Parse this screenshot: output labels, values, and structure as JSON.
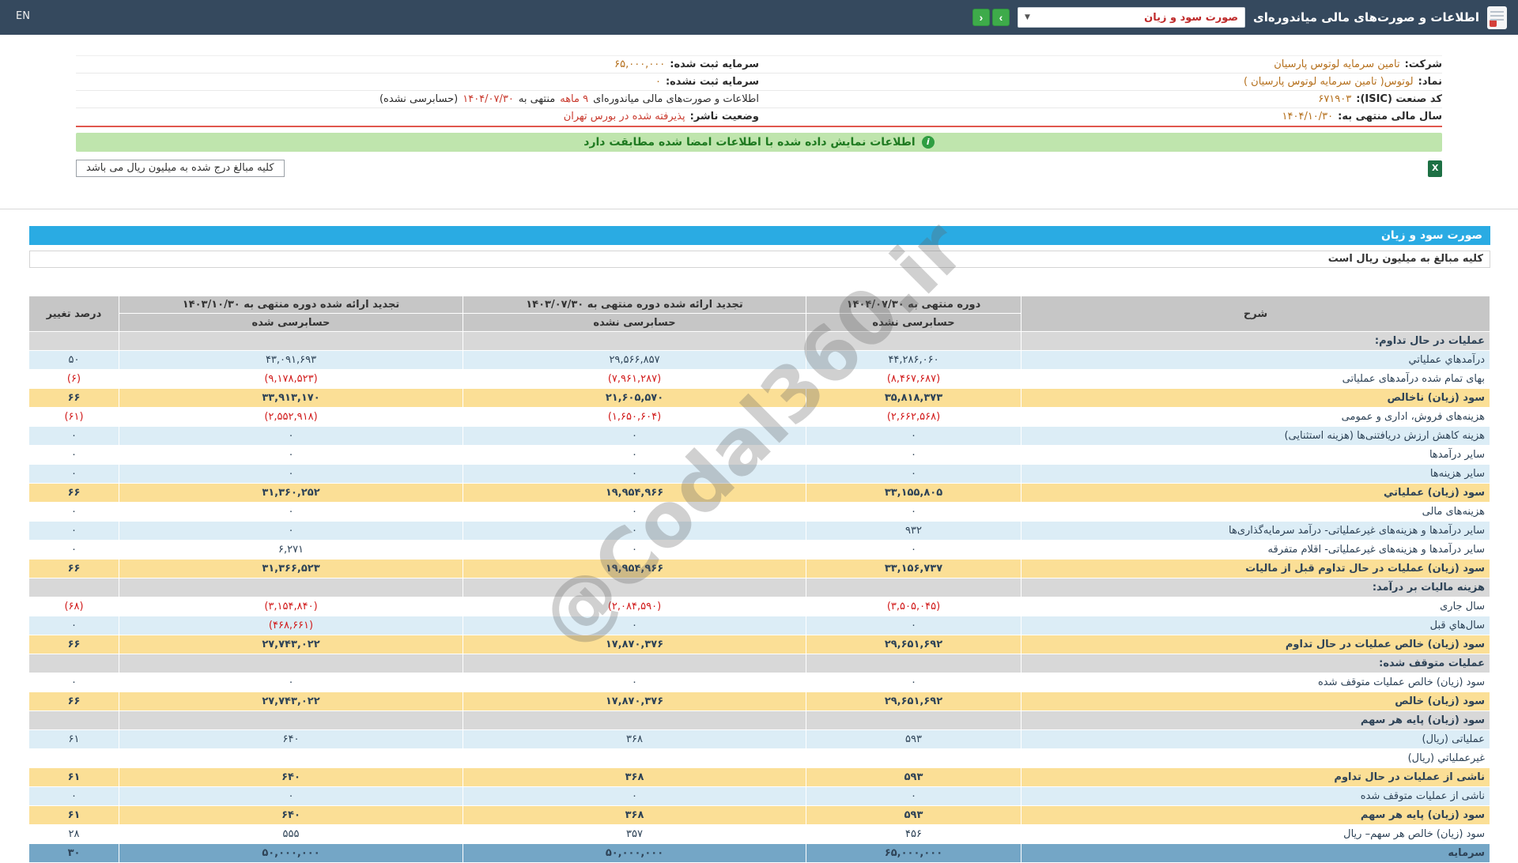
{
  "topbar": {
    "title": "اطلاعات و صورت‌های مالی میاندوره‌ای",
    "select_value": "صورت سود و زیان",
    "en_label": "EN"
  },
  "company": {
    "right": [
      {
        "label": "شرکت:",
        "value": "تامین سرمایه لوتوس پارسیان",
        "color": "orange"
      },
      {
        "label": "نماد:",
        "value": "لوتوس( تامین سرمایه لوتوس پارسیان )",
        "color": "orange"
      },
      {
        "label": "کد صنعت (ISIC):",
        "value": "۶۷۱۹۰۳",
        "color": "orange"
      },
      {
        "label": "سال مالی منتهی به:",
        "value": "۱۴۰۴/۱۰/۳۰",
        "color": "orange"
      }
    ],
    "left": [
      {
        "label": "سرمایه ثبت شده:",
        "value": "۶۵,۰۰۰,۰۰۰",
        "color": "orange"
      },
      {
        "label": "سرمایه ثبت نشده:",
        "value": "۰",
        "color": "orange"
      },
      {
        "segments": [
          {
            "text": "اطلاعات و صورت‌های مالی میاندوره‌ای ",
            "cls": "dark"
          },
          {
            "text": "۹ ماهه",
            "cls": "red"
          },
          {
            "text": " منتهی به ",
            "cls": "dark"
          },
          {
            "text": "۱۴۰۴/۰۷/۳۰",
            "cls": "red"
          },
          {
            "text": "(حسابرسی نشده)",
            "cls": "dark"
          }
        ]
      },
      {
        "label": "وضعیت ناشر:",
        "value": "پذیرفته شده در بورس تهران",
        "color": "red"
      }
    ]
  },
  "banner": {
    "text": "اطلاعات نمایش داده شده با اطلاعات امضا شده مطابقت دارد"
  },
  "note": {
    "text": "کلیه مبالغ درج شده به میلیون ریال می باشد"
  },
  "statement": {
    "title": "صورت سود و زیان",
    "subtitle": "کلیه مبالغ به میلیون ریال است"
  },
  "table": {
    "headers": {
      "desc": "شرح",
      "col1_title": "دوره منتهی به ۱۴۰۴/۰۷/۳۰",
      "col1_sub": "حسابرسی نشده",
      "col2_title": "تجدید ارائه شده دوره منتهی به ۱۴۰۳/۰۷/۳۰",
      "col2_sub": "حسابرسی نشده",
      "col3_title": "تجدید ارائه شده دوره منتهی به ۱۴۰۳/۱۰/۳۰",
      "col3_sub": "حسابرسی شده",
      "pct": "درصد تغییر"
    },
    "rows": [
      {
        "type": "section",
        "label": "عملیات در حال تداوم:"
      },
      {
        "type": "data",
        "style": "blue",
        "label": "درآمدهاي عملياتي",
        "c1": "۴۴,۲۸۶,۰۶۰",
        "c2": "۲۹,۵۶۶,۸۵۷",
        "c3": "۴۳,۰۹۱,۶۹۳",
        "pct": "۵۰"
      },
      {
        "type": "data",
        "style": "white",
        "label": "بهای تمام شده درآمدهای عملیاتی",
        "c1": "(۸,۴۶۷,۶۸۷)",
        "c2": "(۷,۹۶۱,۲۸۷)",
        "c3": "(۹,۱۷۸,۵۲۳)",
        "pct": "(۶)"
      },
      {
        "type": "data",
        "style": "yellow",
        "label": "سود (زيان) ناخالص",
        "c1": "۳۵,۸۱۸,۳۷۳",
        "c2": "۲۱,۶۰۵,۵۷۰",
        "c3": "۳۳,۹۱۳,۱۷۰",
        "pct": "۶۶"
      },
      {
        "type": "data",
        "style": "white",
        "label": "هزینه‌هاى فروش، ادارى و عمومى",
        "c1": "(۲,۶۶۲,۵۶۸)",
        "c2": "(۱,۶۵۰,۶۰۴)",
        "c3": "(۲,۵۵۲,۹۱۸)",
        "pct": "(۶۱)"
      },
      {
        "type": "data",
        "style": "blue",
        "label": "هزینه کاهش ارزش دریافتنی‌ها (هزینه استثنایی)",
        "c1": "۰",
        "c2": "۰",
        "c3": "۰",
        "pct": "۰"
      },
      {
        "type": "data",
        "style": "white",
        "label": "سایر درآمدها",
        "c1": "۰",
        "c2": "۰",
        "c3": "۰",
        "pct": "۰"
      },
      {
        "type": "data",
        "style": "blue",
        "label": "سایر هزینه‌ها",
        "c1": "۰",
        "c2": "۰",
        "c3": "۰",
        "pct": "۰"
      },
      {
        "type": "data",
        "style": "yellow",
        "label": "سود (زيان) عملياتي",
        "c1": "۳۳,۱۵۵,۸۰۵",
        "c2": "۱۹,۹۵۴,۹۶۶",
        "c3": "۳۱,۳۶۰,۲۵۲",
        "pct": "۶۶"
      },
      {
        "type": "data",
        "style": "white",
        "label": "هزینه‌هاى مالى",
        "c1": "۰",
        "c2": "۰",
        "c3": "۰",
        "pct": "۰"
      },
      {
        "type": "data",
        "style": "blue",
        "label": "سایر درآمدها و هزینه‌های غیرعملیاتی- درآمد سرمایه‌گذاری‌ها",
        "c1": "۹۳۲",
        "c2": "۰",
        "c3": "۰",
        "pct": "۰"
      },
      {
        "type": "data",
        "style": "white",
        "label": "سایر درآمدها و هزینه‌های غیرعملیاتی- اقلام متفرقه",
        "c1": "۰",
        "c2": "۰",
        "c3": "۶,۲۷۱",
        "pct": "۰"
      },
      {
        "type": "data",
        "style": "yellow",
        "label": "سود (زيان) عمليات در حال تداوم قبل از ماليات",
        "c1": "۳۳,۱۵۶,۷۳۷",
        "c2": "۱۹,۹۵۴,۹۶۶",
        "c3": "۳۱,۳۶۶,۵۲۳",
        "pct": "۶۶"
      },
      {
        "type": "section",
        "label": "هزینه مالیات بر درآمد:"
      },
      {
        "type": "data",
        "style": "white",
        "label": "سال جاری",
        "c1": "(۳,۵۰۵,۰۴۵)",
        "c2": "(۲,۰۸۴,۵۹۰)",
        "c3": "(۳,۱۵۴,۸۴۰)",
        "pct": "(۶۸)"
      },
      {
        "type": "data",
        "style": "blue",
        "label": "سال‌هاي قبل",
        "c1": "۰",
        "c2": "۰",
        "c3": "(۴۶۸,۶۶۱)",
        "pct": "۰"
      },
      {
        "type": "data",
        "style": "yellow",
        "label": "سود (زيان) خالص عمليات در حال تداوم",
        "c1": "۲۹,۶۵۱,۶۹۲",
        "c2": "۱۷,۸۷۰,۳۷۶",
        "c3": "۲۷,۷۴۳,۰۲۲",
        "pct": "۶۶"
      },
      {
        "type": "section",
        "label": "عملیات متوقف شده:"
      },
      {
        "type": "data",
        "style": "white",
        "label": "سود (زیان) خالص عملیات متوقف شده",
        "c1": "۰",
        "c2": "۰",
        "c3": "۰",
        "pct": "۰"
      },
      {
        "type": "data",
        "style": "yellow",
        "label": "سود (زیان) خالص",
        "c1": "۲۹,۶۵۱,۶۹۲",
        "c2": "۱۷,۸۷۰,۳۷۶",
        "c3": "۲۷,۷۴۳,۰۲۲",
        "pct": "۶۶"
      },
      {
        "type": "section",
        "label": "سود (زیان) پایه هر سهم"
      },
      {
        "type": "data",
        "style": "blue",
        "label": "عملیاتی (ریال)",
        "c1": "۵۹۳",
        "c2": "۳۶۸",
        "c3": "۶۴۰",
        "pct": "۶۱"
      },
      {
        "type": "data",
        "style": "white",
        "label": "غیرعملیاتي (ریال)",
        "c1": "",
        "c2": "",
        "c3": "",
        "pct": ""
      },
      {
        "type": "data",
        "style": "yellow",
        "label": "ناشی از عملیات در حال تداوم",
        "c1": "۵۹۳",
        "c2": "۳۶۸",
        "c3": "۶۴۰",
        "pct": "۶۱"
      },
      {
        "type": "data",
        "style": "blue",
        "label": "ناشی از عملیات متوقف شده",
        "c1": "۰",
        "c2": "۰",
        "c3": "۰",
        "pct": "۰"
      },
      {
        "type": "data",
        "style": "yellow",
        "label": "سود (زیان) پایه هر سهم",
        "c1": "۵۹۳",
        "c2": "۳۶۸",
        "c3": "۶۴۰",
        "pct": "۶۱"
      },
      {
        "type": "data",
        "style": "white",
        "label": "سود (زیان) خالص هر سهم– ریال",
        "c1": "۴۵۶",
        "c2": "۳۵۷",
        "c3": "۵۵۵",
        "pct": "۲۸"
      },
      {
        "type": "data",
        "style": "capital",
        "label": "سرمایه",
        "c1": "۶۵,۰۰۰,۰۰۰",
        "c2": "۵۰,۰۰۰,۰۰۰",
        "c3": "۵۰,۰۰۰,۰۰۰",
        "pct": "۳۰"
      }
    ]
  },
  "watermark": {
    "text": "@Codal360.ir"
  },
  "colors": {
    "topbar_bg": "#35495e",
    "nav_green": "#3eab4a",
    "title_bar_blue": "#2aabe3",
    "row_yellow": "#fbdf96",
    "row_blue": "#dcedf6",
    "section_gray": "#d8d8d8",
    "header_gray": "#c6c6c6",
    "negative_red": "#d11a1a",
    "value_orange": "#b5701d",
    "banner_green_bg": "#bfe5ad",
    "banner_green_text": "#1f7a21"
  }
}
